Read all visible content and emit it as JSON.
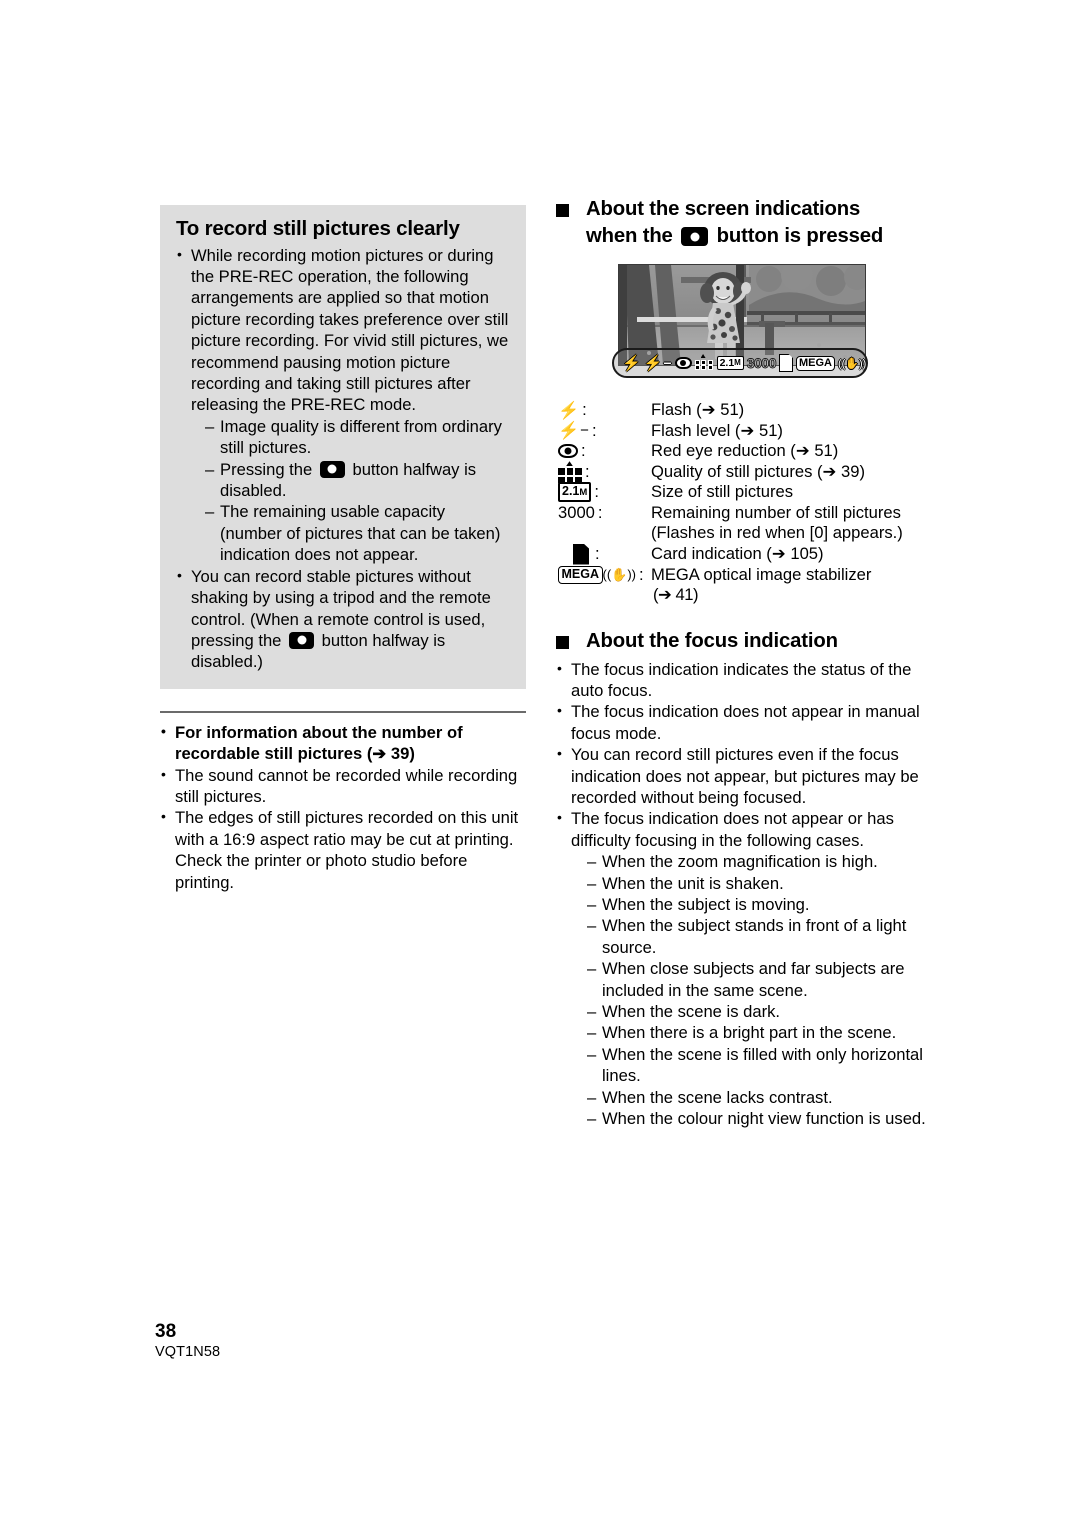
{
  "page": {
    "number": "38",
    "code": "VQT1N58"
  },
  "left_column": {
    "panel": {
      "title": "To record still pictures clearly",
      "bullets": [
        {
          "text": "While recording motion pictures or during the PRE-REC operation, the following arrangements are applied so that motion picture recording takes preference over still picture recording. For vivid still pictures, we recommend pausing motion picture recording and taking still pictures after releasing the PRE-REC mode.",
          "sub": [
            {
              "pre": "Image quality is different from ordinary still pictures.",
              "icon": null,
              "post": ""
            },
            {
              "pre": "Pressing the ",
              "icon": "camera-button-icon",
              "post": " button halfway is disabled."
            },
            {
              "pre": "The remaining usable capacity (number of pictures that can be taken) indication does not appear.",
              "icon": null,
              "post": ""
            }
          ]
        },
        {
          "pre": "You can record stable pictures without shaking by using a tripod and the remote control. (When a remote control is used, pressing the ",
          "icon": "camera-button-icon",
          "post": " button halfway is disabled.)"
        }
      ]
    },
    "after_panel": {
      "bullets": [
        {
          "bold": true,
          "text": "For information about the number of recordable still pictures (➔ 39)"
        },
        {
          "bold": false,
          "text": "The sound cannot be recorded while recording still pictures."
        },
        {
          "bold": false,
          "text": "The edges of still pictures recorded on this unit with a 16:9 aspect ratio may be cut at printing. Check the printer or photo studio before printing."
        }
      ]
    }
  },
  "right_column": {
    "heading_screen": {
      "line1": "About the screen indications",
      "line2_pre": "when the ",
      "line2_icon": "camera-button-icon",
      "line2_post": " button is pressed"
    },
    "osd": {
      "flash": "⚡",
      "flash_level": "⚡",
      "flash_level_minus": "−",
      "size_label": "2.1",
      "size_unit": "M",
      "remaining": "3000",
      "mega_label": "MEGA"
    },
    "legend": [
      {
        "sym": "flash-icon",
        "desc": "Flash (➔ 51)"
      },
      {
        "sym": "flash-level-icon",
        "desc": "Flash level (➔ 51)"
      },
      {
        "sym": "red-eye-icon",
        "desc": "Red eye reduction (➔ 51)"
      },
      {
        "sym": "quality-icon",
        "desc": "Quality of still pictures (➔ 39)"
      },
      {
        "sym": "size-box-icon",
        "desc": "Size of still pictures"
      },
      {
        "sym": "3000",
        "desc": "Remaining number of still pictures",
        "cont": "(Flashes in red when [0] appears.)"
      },
      {
        "sym": "card-icon",
        "desc": "Card indication (➔ 105)"
      },
      {
        "sym": "mega-ois-icon",
        "desc": "MEGA optical image stabilizer",
        "cont": "(➔ 41)"
      }
    ],
    "heading_focus": "About the focus indication",
    "focus_bullets": [
      {
        "text": "The focus indication indicates the status of the auto focus."
      },
      {
        "text": "The focus indication does not appear in manual focus mode."
      },
      {
        "text": "You can record still pictures even if the focus indication does not appear, but pictures may be recorded without being focused."
      },
      {
        "text": "The focus indication does not appear or has difficulty focusing in the following cases.",
        "sub": [
          "When the zoom magnification is high.",
          "When the unit is shaken.",
          "When the subject is moving.",
          "When the subject stands in front of a light source.",
          "When close subjects and far subjects are included in the same scene.",
          "When the scene is dark.",
          "When there is a bright part in the scene.",
          "When the scene is filled with only horizontal lines.",
          "When the scene lacks contrast.",
          "When the colour night view function is used."
        ]
      }
    ]
  },
  "colors": {
    "panel_bg": "#dddddd",
    "text": "#000000",
    "divider": "#6b6b6b"
  }
}
